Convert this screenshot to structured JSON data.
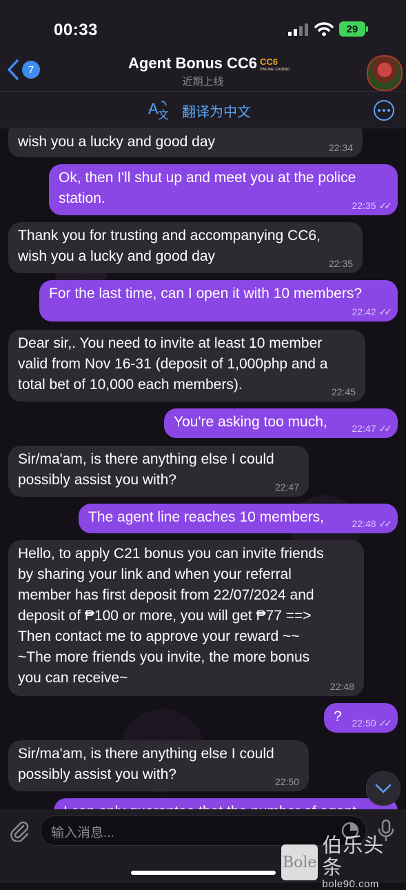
{
  "status": {
    "time": "00:33",
    "battery": "29"
  },
  "header": {
    "back_count": "7",
    "title": "Agent Bonus CC6",
    "title_logo": "CC6",
    "title_logo_small": "ONLINE CASINO",
    "subtitle": "近期上线",
    "translate_label": "翻译为中文"
  },
  "messages": [
    {
      "dir": "in",
      "text": "wish you a lucky and good day",
      "time": "22:34"
    },
    {
      "dir": "out",
      "text": "Ok, then I'll shut up and meet you at the police\nstation.",
      "time": "22:35"
    },
    {
      "dir": "in",
      "text": "Thank you for trusting and accompanying CC6,\nwish you a lucky and good day",
      "time": "22:35"
    },
    {
      "dir": "out",
      "text": "For the last time, can I open it with 10 members?",
      "time": "22:42"
    },
    {
      "dir": "in",
      "text": "Dear sir,. You need to invite at least 10 member\nvalid from Nov 16-31 (deposit of 1,000php and a\ntotal bet of 10,000 each members).",
      "time": "22:45"
    },
    {
      "dir": "out",
      "text": "You're asking too much,",
      "time": "22:47"
    },
    {
      "dir": "in",
      "text": "Sir/ma'am, is there anything else I could\npossibly assist you with?",
      "time": "22:47"
    },
    {
      "dir": "out",
      "text": "The agent line reaches 10 members,",
      "time": "22:48"
    },
    {
      "dir": "in",
      "text": "Hello, to apply C21 bonus you can invite friends\nby sharing your link and when your referral\nmember has first deposit from 22/07/2024 and\ndeposit of ₱100 or more, you will get ₱77 ==>\nThen contact me to approve your reward ~~\n~The more friends you invite, the more bonus\nyou can receive~",
      "time": "22:48"
    },
    {
      "dir": "out",
      "text": "?",
      "time": "22:50"
    },
    {
      "dir": "in",
      "text": "Sir/ma'am, is there anything else I could\npossibly assist you with?",
      "time": "22:50"
    },
    {
      "dir": "out",
      "text": "I can only guarantee that the number of agent",
      "time": ""
    }
  ],
  "input": {
    "placeholder": "输入消息..."
  },
  "watermark": {
    "box": "Bole",
    "cn": "伯乐头条",
    "url": "bole90.com"
  },
  "colors": {
    "outgoing": "#8b46e6",
    "incoming": "#2d2a31",
    "accent": "#5aa5ff"
  },
  "icons": [
    "back-chevron-icon",
    "signal-icon",
    "wifi-icon",
    "battery-icon",
    "translate-icon",
    "more-icon",
    "read-check-icon",
    "scroll-down-icon",
    "attach-icon",
    "sticker-icon",
    "mic-icon"
  ]
}
